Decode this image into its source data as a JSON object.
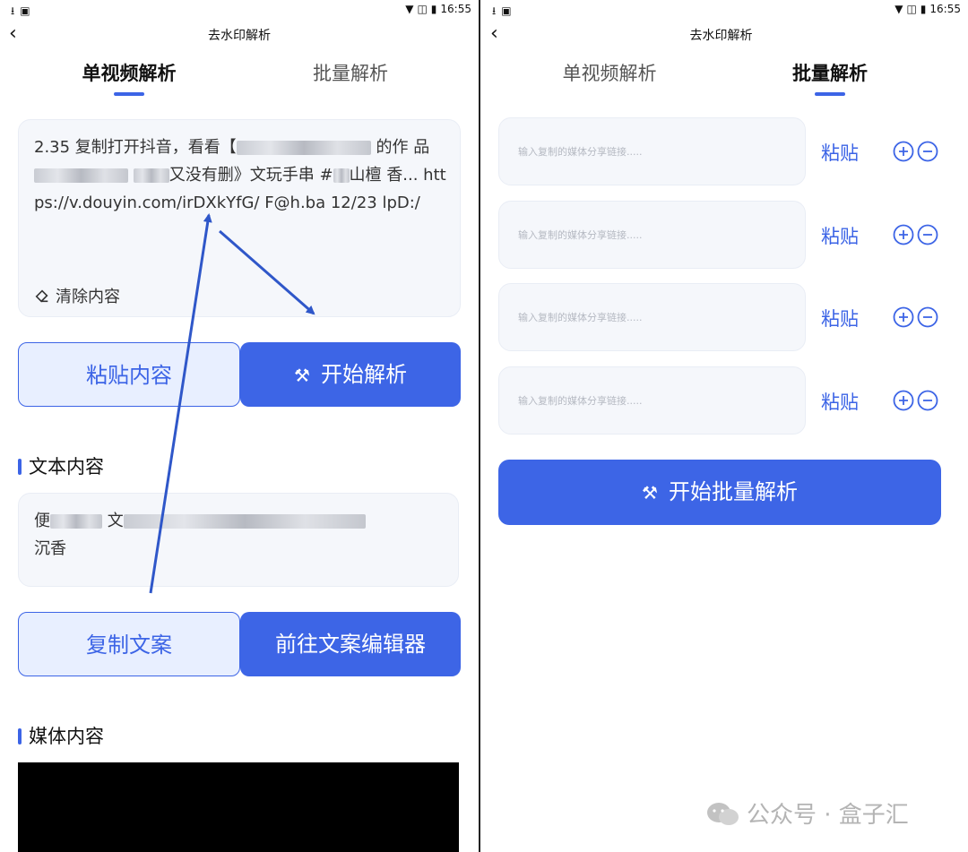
{
  "colors": {
    "accent": "#3d65e6",
    "accent_light": "#e8efff",
    "card_bg": "#f5f7fb"
  },
  "status_bar": {
    "time": "16:55",
    "left_icons": [
      "download-icon",
      "image-icon"
    ],
    "right_icons": [
      "wifi-icon",
      "no-sim-icon",
      "battery-icon"
    ]
  },
  "left": {
    "title": "去水印解析",
    "tabs": [
      {
        "label": "单视频解析",
        "active": true
      },
      {
        "label": "批量解析",
        "active": false
      }
    ],
    "share_text": {
      "prefix": "2.35 复制打开抖音，看看【",
      "mid1": "的作",
      "mid2": "品",
      "mid3": "又没有删》文玩手串 #",
      "mid4": "山檀",
      "link": "香... https://v.douyin.com/irDXkYfG/ F@h.ba 12/23 lpD:/"
    },
    "clear_label": "清除内容",
    "paste_button": "粘贴内容",
    "parse_button": "开始解析",
    "text_section_title": "文本内容",
    "copy_text": {
      "start": "便",
      "mid": "文",
      "end": "沉香"
    },
    "copy_button": "复制文案",
    "editor_button": "前往文案编辑器",
    "media_section_title": "媒体内容"
  },
  "right": {
    "title": "去水印解析",
    "tabs": [
      {
        "label": "单视频解析",
        "active": false
      },
      {
        "label": "批量解析",
        "active": true
      }
    ],
    "link_placeholder": "输入复制的媒体分享链接.....",
    "paste_label": "粘贴",
    "rows": [
      {},
      {},
      {},
      {}
    ],
    "batch_button": "开始批量解析"
  },
  "watermark": "公众号 · 盒子汇"
}
